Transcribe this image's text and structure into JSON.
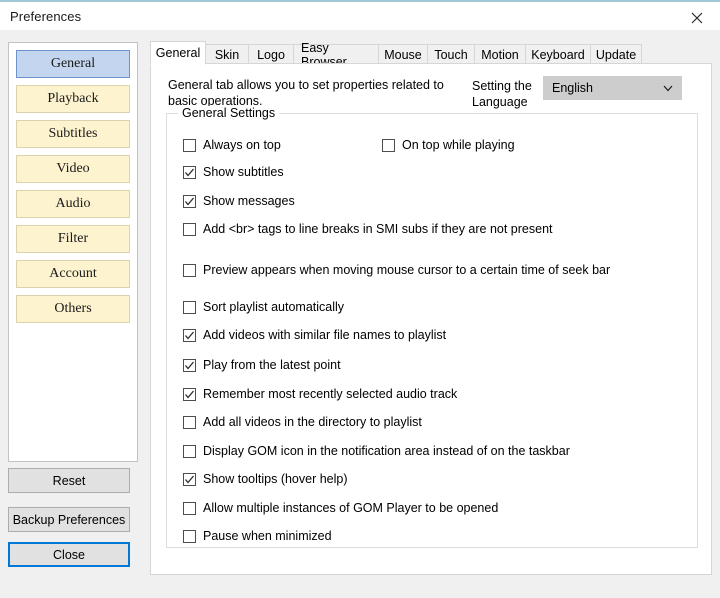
{
  "window": {
    "title": "Preferences",
    "close_icon": "close-icon"
  },
  "sidebar": {
    "items": [
      {
        "label": "General",
        "selected": true
      },
      {
        "label": "Playback",
        "selected": false
      },
      {
        "label": "Subtitles",
        "selected": false
      },
      {
        "label": "Video",
        "selected": false
      },
      {
        "label": "Audio",
        "selected": false
      },
      {
        "label": "Filter",
        "selected": false
      },
      {
        "label": "Account",
        "selected": false
      },
      {
        "label": "Others",
        "selected": false
      }
    ],
    "buttons": {
      "reset": "Reset",
      "backup": "Backup Preferences",
      "close": "Close"
    }
  },
  "tabs": [
    {
      "label": "General",
      "active": true
    },
    {
      "label": "Skin",
      "active": false
    },
    {
      "label": "Logo",
      "active": false
    },
    {
      "label": "Easy Browser",
      "active": false
    },
    {
      "label": "Mouse",
      "active": false
    },
    {
      "label": "Touch",
      "active": false
    },
    {
      "label": "Motion",
      "active": false
    },
    {
      "label": "Keyboard",
      "active": false
    },
    {
      "label": "Update",
      "active": false
    }
  ],
  "main": {
    "intro": "General tab allows you to set properties related to basic operations.",
    "language_label": "Setting the Language",
    "language_value": "English",
    "language_arrow_icon": "chevron-down-icon",
    "group_legend": "General Settings",
    "checkboxes": [
      {
        "label": "Always on top",
        "checked": false
      },
      {
        "label": "On top while playing",
        "checked": false
      },
      {
        "label": "Show subtitles",
        "checked": true
      },
      {
        "label": "Show messages",
        "checked": true
      },
      {
        "label": "Add <br> tags to line breaks in SMI subs if they are not present",
        "checked": false
      },
      {
        "label": "Preview appears when moving mouse cursor to a certain time of seek bar",
        "checked": false
      },
      {
        "label": "Sort playlist automatically",
        "checked": false
      },
      {
        "label": "Add videos with similar file names to playlist",
        "checked": true
      },
      {
        "label": "Play from the latest point",
        "checked": true
      },
      {
        "label": "Remember most recently selected audio track",
        "checked": true
      },
      {
        "label": "Add all videos in the directory to playlist",
        "checked": false
      },
      {
        "label": "Display GOM icon in the notification area instead of on the taskbar",
        "checked": false
      },
      {
        "label": "Show tooltips (hover help)",
        "checked": true
      },
      {
        "label": "Allow multiple instances of GOM Player to be opened",
        "checked": false
      },
      {
        "label": "Pause when minimized",
        "checked": false
      }
    ]
  },
  "colors": {
    "accent": "#0078d7",
    "titlebar_line": "#9ec7d8",
    "nav_default": "#fdf3cf",
    "nav_selected": "#c4d6ef",
    "combo_bg": "#cdcdcd"
  }
}
